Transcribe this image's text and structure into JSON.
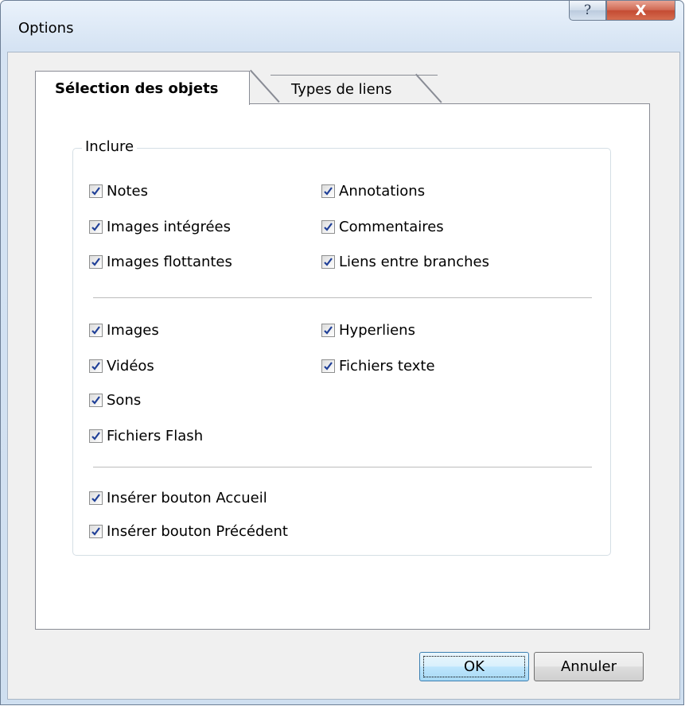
{
  "window": {
    "title": "Options",
    "help_label": "?",
    "close_label": "X"
  },
  "tabs": [
    {
      "label": "Sélection des objets",
      "active": true
    },
    {
      "label": "Types de liens",
      "active": false
    }
  ],
  "group": {
    "legend": "Inclure",
    "section1": {
      "left": [
        {
          "label": "Notes",
          "checked": true
        },
        {
          "label": "Images intégrées",
          "checked": true
        },
        {
          "label": "Images flottantes",
          "checked": true
        }
      ],
      "right": [
        {
          "label": "Annotations",
          "checked": true
        },
        {
          "label": "Commentaires",
          "checked": true
        },
        {
          "label": "Liens entre branches",
          "checked": true
        }
      ]
    },
    "section2": {
      "left": [
        {
          "label": "Images",
          "checked": true
        },
        {
          "label": "Vidéos",
          "checked": true
        },
        {
          "label": "Sons",
          "checked": true
        },
        {
          "label": "Fichiers Flash",
          "checked": true
        }
      ],
      "right": [
        {
          "label": "Hyperliens",
          "checked": true
        },
        {
          "label": "Fichiers texte",
          "checked": true
        }
      ]
    },
    "section3": [
      {
        "label": "Insérer bouton Accueil",
        "checked": true
      },
      {
        "label": "Insérer bouton Précédent",
        "checked": true
      }
    ]
  },
  "buttons": {
    "ok": "OK",
    "cancel": "Annuler"
  }
}
